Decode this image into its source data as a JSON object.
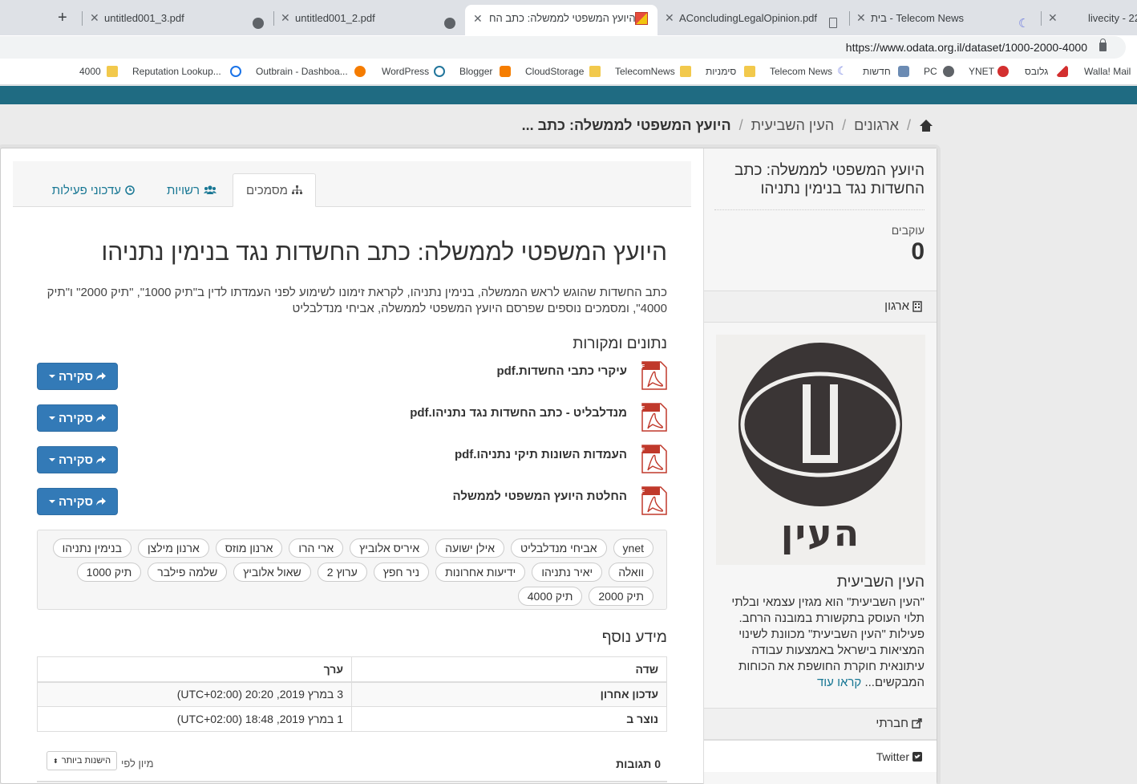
{
  "browser": {
    "tabs": [
      {
        "title": "untitled001_3.pdf"
      },
      {
        "title": "untitled001_2.pdf"
      },
      {
        "title": "היועץ המשפטי לממשלה: כתב הח"
      },
      {
        "title": "AConcludingLegalOpinion.pdf"
      },
      {
        "title": "בית - Telecom News"
      },
      {
        "title": "livecity - 22"
      }
    ],
    "url": "https://www.odata.org.il/dataset/1000-2000-4000",
    "bookmarks": [
      "4000",
      "Reputation Lookup...",
      "Outbrain - Dashboa...",
      "WordPress",
      "Blogger",
      "CloudStorage",
      "TelecomNews",
      "סימניות",
      "Telecom News",
      "חדשות",
      "PC",
      "YNET",
      "גלובס",
      "Walla! Mail"
    ]
  },
  "breadcrumb": {
    "org_list": "ארגונים",
    "org": "העין השביעית",
    "current": "היועץ המשפטי לממשלה: כתב ..."
  },
  "sidebar": {
    "title": "היועץ המשפטי לממשלה: כתב החשדות נגד בנימין נתניהו",
    "followers_label": "עוקבים",
    "followers_count": "0",
    "org_heading": "ארגון",
    "org_name": "העין השביעית",
    "logo_text": "העין השביעית",
    "org_desc": "\"העין השביעית\" הוא מגזין עצמאי ובלתי תלוי העוסק בתקשורת במובנה הרחב. פעילות \"העין השביעית\" מכוונת לשינוי המציאות בישראל באמצעות עבודה עיתונאית חוקרת החושפת את הכוחות המבקשים...",
    "read_more": "קראו עוד",
    "social_heading": "חברתי",
    "twitter": "Twitter"
  },
  "tabs": {
    "datasets": "מסמכים",
    "groups": "רשויות",
    "activity": "עדכוני פעילות"
  },
  "dataset": {
    "title": "היועץ המשפטי לממשלה: כתב החשדות נגד בנימין נתניהו",
    "notes": "כתב החשדות שהוגש לראש הממשלה, בנימין נתניהו, לקראת זימונו לשימוע לפני העמדתו לדין ב\"תיק 1000\", \"תיק 2000\" ו\"תיק 4000\", ומסמכים נוספים שפרסם היועץ המשפטי לממשלה, אביחי מנדלבליט",
    "resources_heading": "נתונים ומקורות",
    "explore_label": "סקירה",
    "resources": [
      {
        "title": "עיקרי כתבי החשדות.pdf",
        "format": "PDF"
      },
      {
        "title": "מנדלבליט - כתב החשדות נגד נתניהו.pdf",
        "format": "PDF"
      },
      {
        "title": "העמדות השונות תיקי נתניהו.pdf",
        "format": "PDF"
      },
      {
        "title": "החלטת היועץ המשפטי לממשלה",
        "format": "PDF"
      }
    ],
    "tags": [
      "ynet",
      "אביחי מנדלבליט",
      "אילן ישועה",
      "איריס אלוביץ",
      "ארי הרו",
      "ארנון מוזס",
      "ארנון מילצן",
      "בנימין נתניהו",
      "וואלה",
      "יאיר נתניהו",
      "ידיעות אחרונות",
      "ניר חפץ",
      "ערוץ 2",
      "שאול אלוביץ",
      "שלמה פילבר",
      "תיק 1000",
      "תיק 2000",
      "תיק 4000"
    ],
    "additional_heading": "מידע נוסף",
    "table": {
      "col_field": "שדה",
      "col_value": "ערך",
      "rows": [
        {
          "field": "עדכון אחרון",
          "value": "3 במרץ 2019, 20:20 (UTC+02:00)"
        },
        {
          "field": "נוצר ב",
          "value": "1 במרץ 2019, 18:48 (UTC+02:00)"
        }
      ]
    },
    "comments": "0 תגובות",
    "sort_label": "מיון לפי",
    "sort_value": "הישנות ביותר"
  },
  "colors": {
    "brand": "#1f6b82",
    "link": "#187794",
    "button": "#337ab7"
  }
}
